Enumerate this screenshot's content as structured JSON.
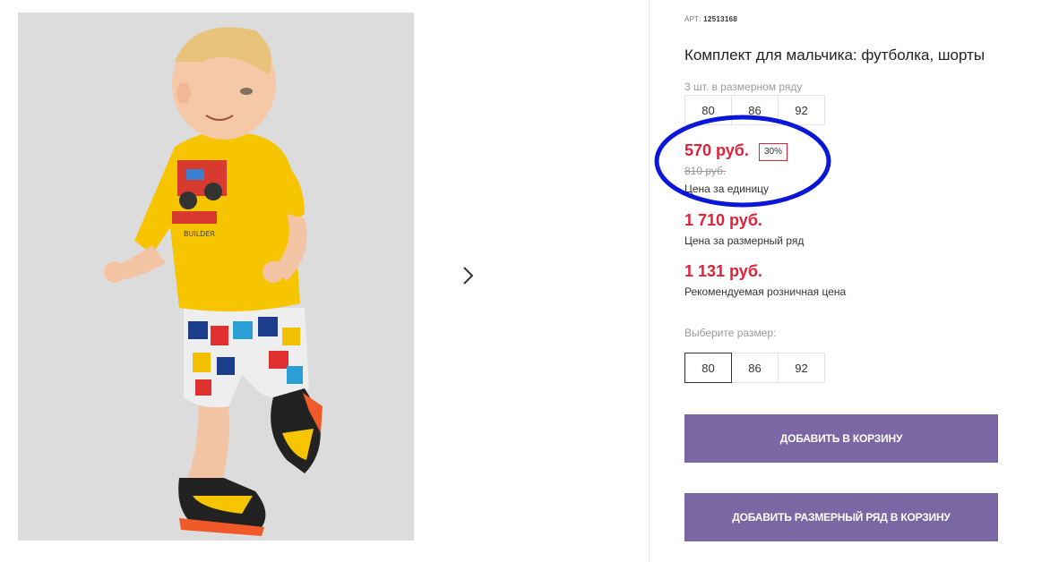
{
  "product": {
    "art_label": "АРТ:",
    "art_number": "12513168",
    "title": "Комплект для мальчика: футболка, шорты",
    "row_size_label": "3 шт. в размерном ряду",
    "row_sizes": [
      "80",
      "86",
      "92"
    ],
    "price_unit": "570 руб.",
    "discount": "30%",
    "price_old": "810 руб.",
    "price_unit_label": "Цена за единицу",
    "price_row": "1 710 руб.",
    "price_row_label": "Цена за размерный ряд",
    "price_retail": "1 131 руб.",
    "price_retail_label": "Рекомендуемая розничная цена",
    "choose_size_label": "Выберите размер:",
    "choose_sizes": [
      "80",
      "86",
      "92"
    ],
    "selected_size": "80"
  },
  "buttons": {
    "add_to_cart": "ДОБАВИТЬ В КОРЗИНУ",
    "add_row_to_cart": "ДОБАВИТЬ РАЗМЕРНЫЙ РЯД В КОРЗИНУ"
  },
  "colors": {
    "accent_price": "#e0213a",
    "button_bg": "#7b67a3",
    "annotation": "#0a16d8"
  },
  "icons": {
    "next": "chevron-right-icon"
  }
}
